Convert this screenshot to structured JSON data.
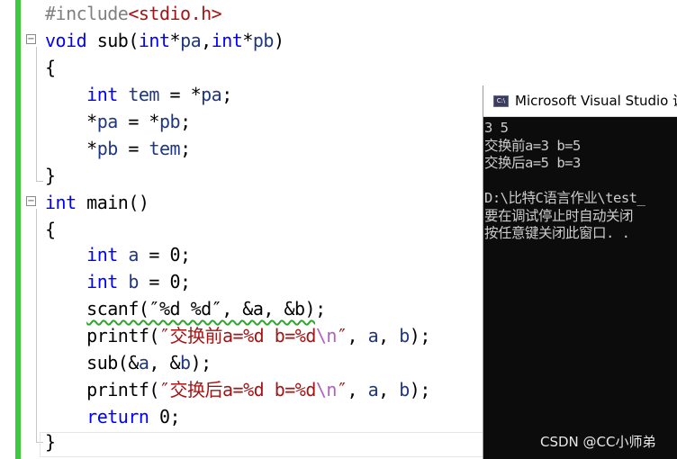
{
  "editor": {
    "lines": [
      {
        "segments": [
          {
            "cls": "pre",
            "text": "#include"
          },
          {
            "cls": "str",
            "text": "<stdio.h>"
          }
        ]
      },
      {
        "segments": [
          {
            "cls": "kw",
            "text": "void"
          },
          {
            "cls": "",
            "text": " sub("
          },
          {
            "cls": "kw",
            "text": "int"
          },
          {
            "cls": "",
            "text": "*"
          },
          {
            "cls": "var",
            "text": "pa"
          },
          {
            "cls": "",
            "text": ","
          },
          {
            "cls": "kw",
            "text": "int"
          },
          {
            "cls": "",
            "text": "*"
          },
          {
            "cls": "var",
            "text": "pb"
          },
          {
            "cls": "",
            "text": ")"
          }
        ]
      },
      {
        "segments": [
          {
            "cls": "",
            "text": "{"
          }
        ]
      },
      {
        "segments": [
          {
            "cls": "",
            "text": "    "
          },
          {
            "cls": "kw",
            "text": "int"
          },
          {
            "cls": "",
            "text": " "
          },
          {
            "cls": "var",
            "text": "tem"
          },
          {
            "cls": "",
            "text": " = *"
          },
          {
            "cls": "var",
            "text": "pa"
          },
          {
            "cls": "",
            "text": ";"
          }
        ]
      },
      {
        "segments": [
          {
            "cls": "",
            "text": "    *"
          },
          {
            "cls": "var",
            "text": "pa"
          },
          {
            "cls": "",
            "text": " = *"
          },
          {
            "cls": "var",
            "text": "pb"
          },
          {
            "cls": "",
            "text": ";"
          }
        ]
      },
      {
        "segments": [
          {
            "cls": "",
            "text": "    *"
          },
          {
            "cls": "var",
            "text": "pb"
          },
          {
            "cls": "",
            "text": " = "
          },
          {
            "cls": "var",
            "text": "tem"
          },
          {
            "cls": "",
            "text": ";"
          }
        ]
      },
      {
        "segments": [
          {
            "cls": "",
            "text": "}"
          }
        ]
      },
      {
        "segments": [
          {
            "cls": "kw",
            "text": "int"
          },
          {
            "cls": "",
            "text": " main()"
          }
        ]
      },
      {
        "segments": [
          {
            "cls": "",
            "text": "{"
          }
        ]
      },
      {
        "segments": [
          {
            "cls": "",
            "text": "    "
          },
          {
            "cls": "kw",
            "text": "int"
          },
          {
            "cls": "",
            "text": " "
          },
          {
            "cls": "var",
            "text": "a"
          },
          {
            "cls": "",
            "text": " = 0;"
          }
        ]
      },
      {
        "segments": [
          {
            "cls": "",
            "text": "    "
          },
          {
            "cls": "kw",
            "text": "int"
          },
          {
            "cls": "",
            "text": " "
          },
          {
            "cls": "var",
            "text": "b"
          },
          {
            "cls": "",
            "text": " = 0;"
          }
        ]
      },
      {
        "segments": [
          {
            "cls": "",
            "text": "    "
          },
          {
            "cls": "squiggle",
            "text": "scanf(″%d %d″, &a, &b)"
          },
          {
            "cls": "",
            "text": ";"
          }
        ]
      },
      {
        "segments": [
          {
            "cls": "",
            "text": "    printf("
          },
          {
            "cls": "str",
            "text": "″交换前a=%d b=%d"
          },
          {
            "cls": "esc",
            "text": "\\n"
          },
          {
            "cls": "str",
            "text": "″"
          },
          {
            "cls": "",
            "text": ", "
          },
          {
            "cls": "var",
            "text": "a"
          },
          {
            "cls": "",
            "text": ", "
          },
          {
            "cls": "var",
            "text": "b"
          },
          {
            "cls": "",
            "text": ");"
          }
        ]
      },
      {
        "segments": [
          {
            "cls": "",
            "text": "    sub(&"
          },
          {
            "cls": "var",
            "text": "a"
          },
          {
            "cls": "",
            "text": ", &"
          },
          {
            "cls": "var",
            "text": "b"
          },
          {
            "cls": "",
            "text": ");"
          }
        ]
      },
      {
        "segments": [
          {
            "cls": "",
            "text": "    printf("
          },
          {
            "cls": "str",
            "text": "″交换后a=%d b=%d"
          },
          {
            "cls": "esc",
            "text": "\\n"
          },
          {
            "cls": "str",
            "text": "″"
          },
          {
            "cls": "",
            "text": ", "
          },
          {
            "cls": "var",
            "text": "a"
          },
          {
            "cls": "",
            "text": ", "
          },
          {
            "cls": "var",
            "text": "b"
          },
          {
            "cls": "",
            "text": ");"
          }
        ]
      },
      {
        "segments": [
          {
            "cls": "",
            "text": "    "
          },
          {
            "cls": "kw",
            "text": "return"
          },
          {
            "cls": "",
            "text": " 0;"
          }
        ]
      },
      {
        "segments": [
          {
            "cls": "",
            "text": "}"
          }
        ]
      }
    ]
  },
  "console": {
    "title": "Microsoft Visual Studio 调",
    "icon": "console-app-icon",
    "lines": [
      "3 5",
      "交换前a=3 b=5",
      "交换后a=5 b=3",
      "",
      "D:\\比特C语言作业\\test_",
      "要在调试停止时自动关闭",
      "按任意键关闭此窗口. ."
    ]
  },
  "watermark": "CSDN @CC小师弟",
  "colors": {
    "keyword": "#0000ff",
    "string": "#a31515",
    "change_bar": "#3ec93e",
    "console_bg": "#0c0c0c"
  }
}
